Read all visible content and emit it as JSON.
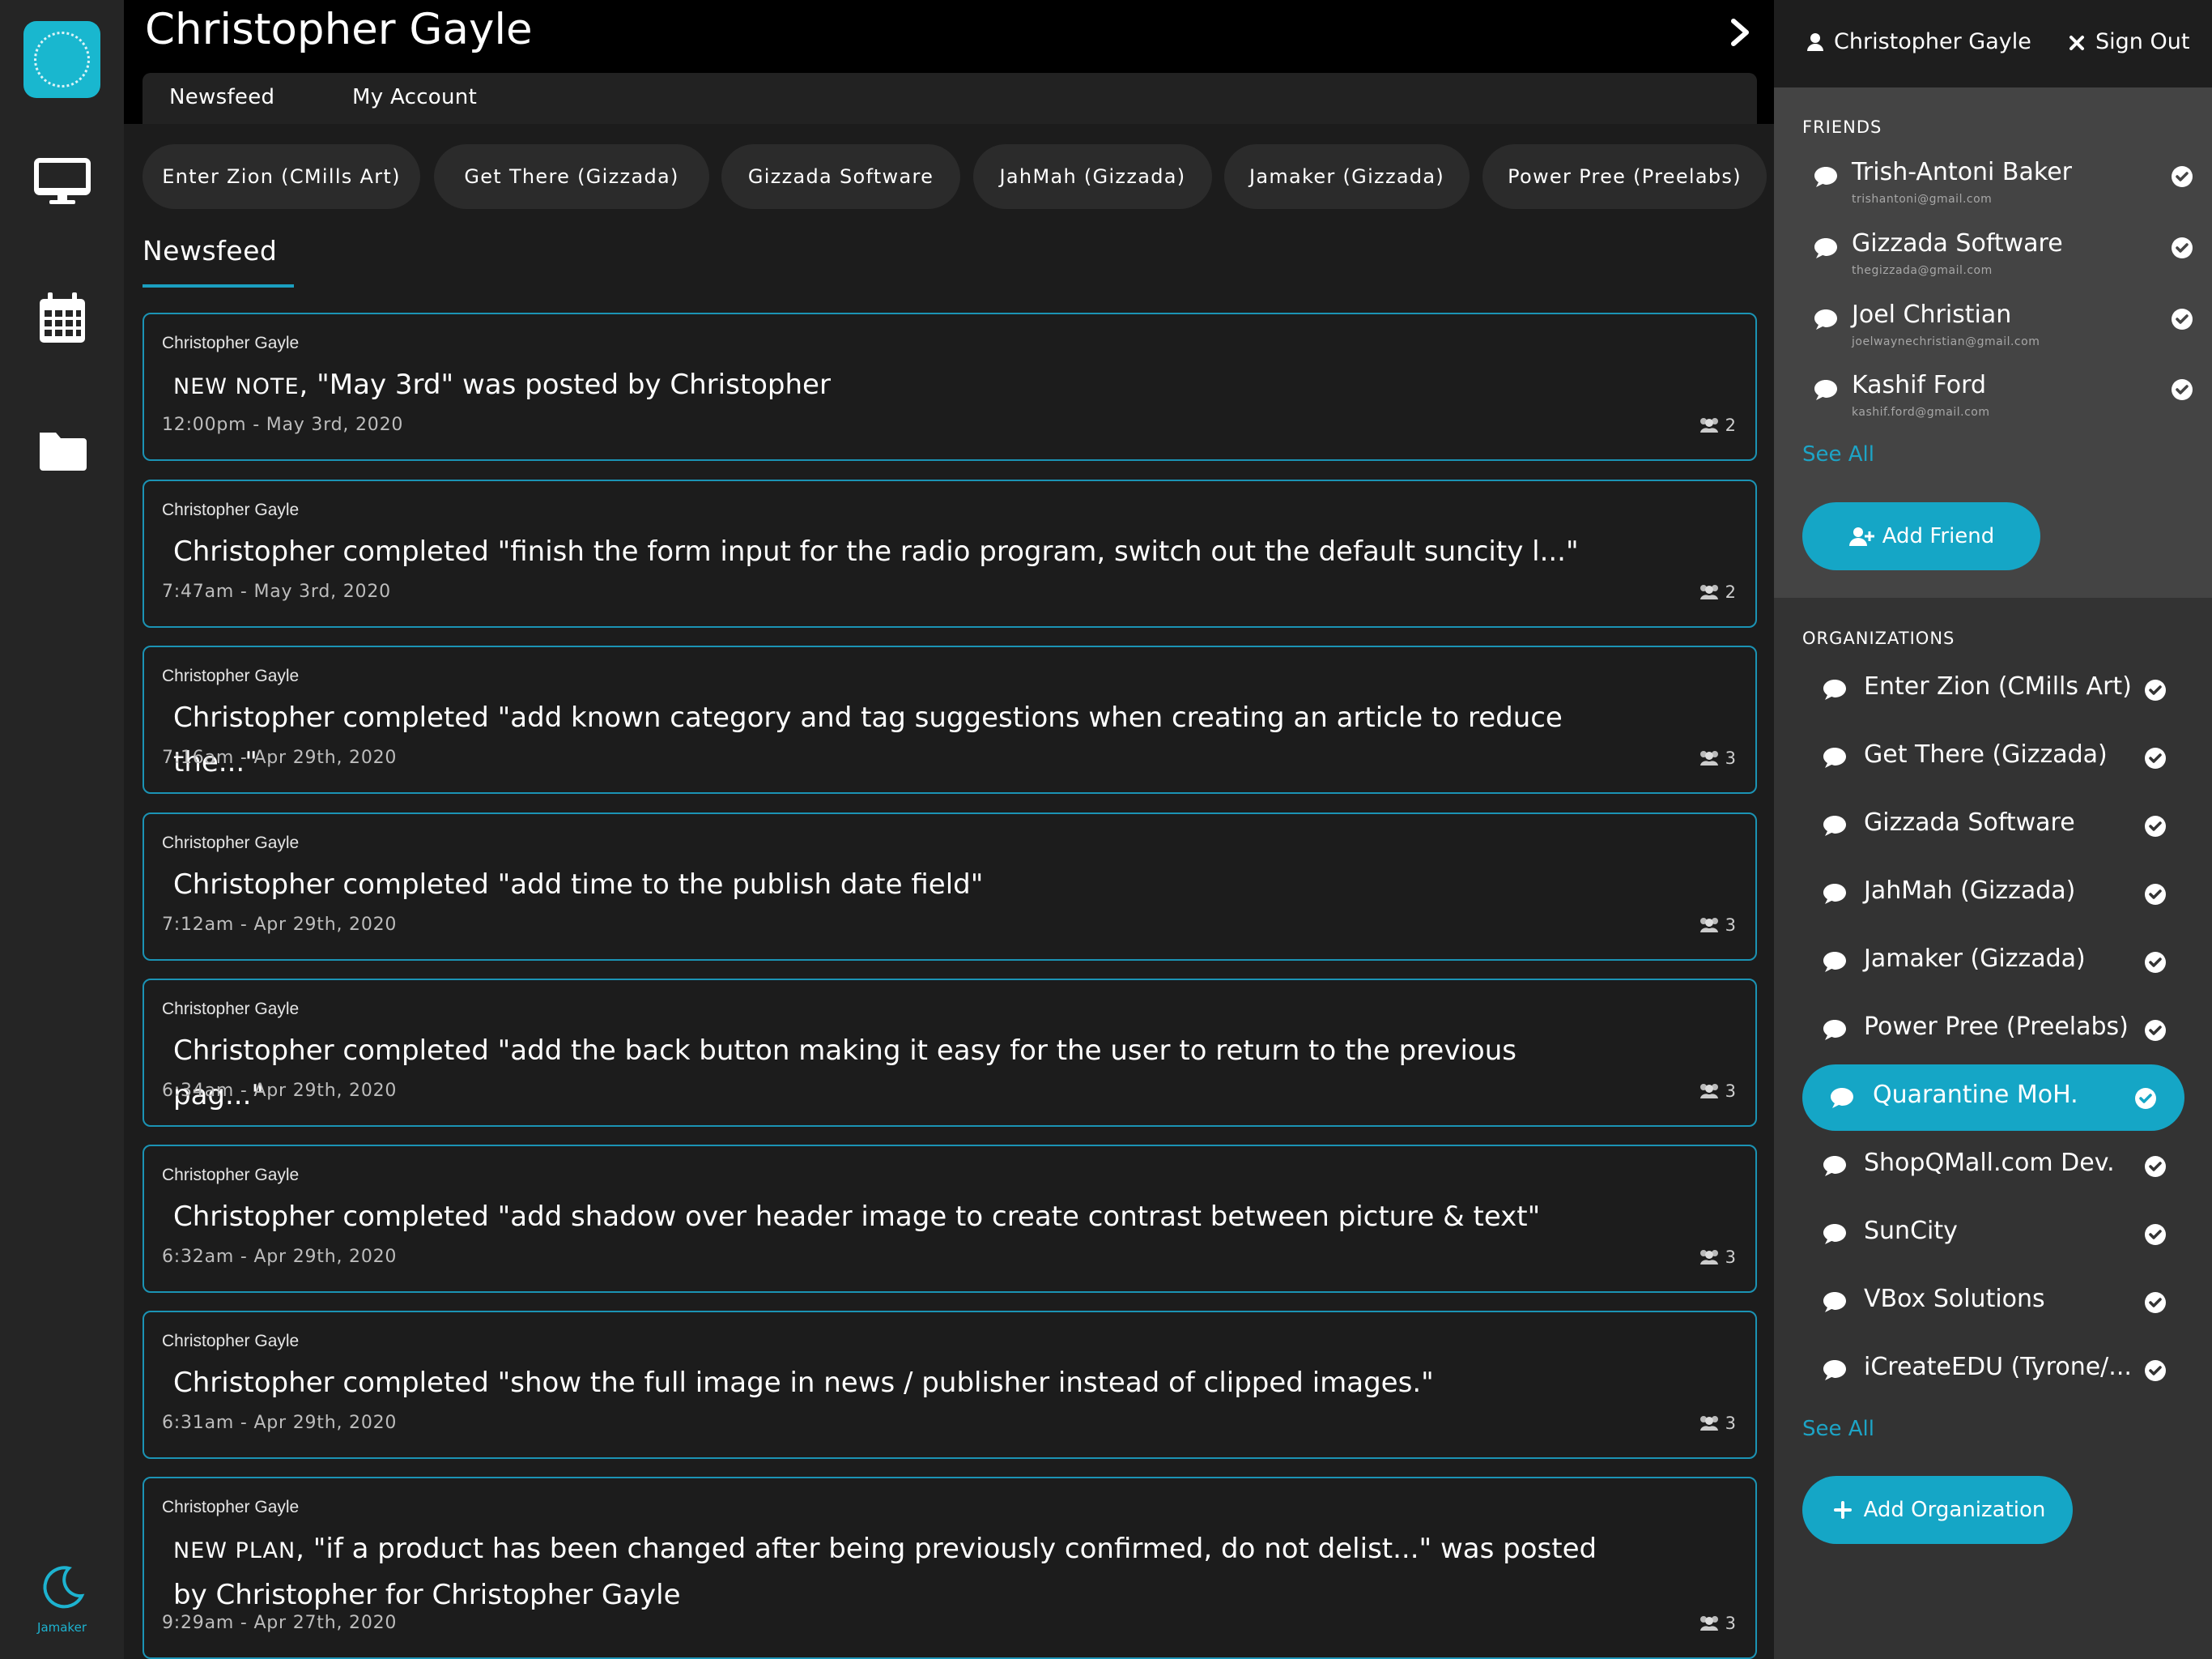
{
  "rail": {
    "app_label": "Jamaker",
    "icons": [
      "app-logo-icon",
      "desktop-icon",
      "calendar-icon",
      "folder-icon",
      "moon-icon"
    ]
  },
  "header": {
    "title": "Christopher Gayle",
    "tabs": [
      {
        "label": "Newsfeed"
      },
      {
        "label": "My Account"
      }
    ]
  },
  "org_pills": [
    {
      "label": "Enter Zion (CMills Art)"
    },
    {
      "label": "Get There (Gizzada)"
    },
    {
      "label": "Gizzada Software"
    },
    {
      "label": "JahMah (Gizzada)"
    },
    {
      "label": "Jamaker (Gizzada)"
    },
    {
      "label": "Power Pree (Preelabs)"
    }
  ],
  "feed": {
    "heading": "Newsfeed",
    "items": [
      {
        "author": "Christopher Gayle",
        "kind": "NEW NOTE",
        "pre": ", ",
        "text": "\"May 3rd\" was posted by Christopher",
        "time": "12:00pm - May 3rd, 2020",
        "count": "2"
      },
      {
        "author": "Christopher Gayle",
        "kind": "",
        "pre": "",
        "text": "Christopher completed \"finish the form input for the radio program, switch out the default suncity l...\"",
        "time": "7:47am - May 3rd, 2020",
        "count": "2"
      },
      {
        "author": "Christopher Gayle",
        "kind": "",
        "pre": "",
        "text": "Christopher completed \"add known category and tag suggestions when creating an article to reduce the...\"",
        "time": "7:16am - Apr 29th, 2020",
        "count": "3"
      },
      {
        "author": "Christopher Gayle",
        "kind": "",
        "pre": "",
        "text": "Christopher completed \"add time to the publish date field\"",
        "time": "7:12am - Apr 29th, 2020",
        "count": "3"
      },
      {
        "author": "Christopher Gayle",
        "kind": "",
        "pre": "",
        "text": "Christopher completed \"add the back button making it easy for the user to return to the previous pag...\"",
        "time": "6:34am - Apr 29th, 2020",
        "count": "3"
      },
      {
        "author": "Christopher Gayle",
        "kind": "",
        "pre": "",
        "text": "Christopher completed \"add shadow over header image to create contrast between picture & text\"",
        "time": "6:32am - Apr 29th, 2020",
        "count": "3"
      },
      {
        "author": "Christopher Gayle",
        "kind": "",
        "pre": "",
        "text": "Christopher completed \"show the full image in news / publisher instead of clipped images.\"",
        "time": "6:31am - Apr 29th, 2020",
        "count": "3"
      },
      {
        "author": "Christopher Gayle",
        "kind": "NEW PLAN",
        "pre": ", ",
        "text": "\"if a product has been changed after being previously confirmed, do not delist...\" was posted by Christopher for Christopher Gayle",
        "time": "9:29am - Apr 27th, 2020",
        "count": "3"
      }
    ]
  },
  "panel": {
    "user_name": "Christopher Gayle",
    "sign_out": "Sign Out",
    "friends_label": "FRIENDS",
    "friends": [
      {
        "name": "Trish-Antoni Baker",
        "email": "trishantoni@gmail.com"
      },
      {
        "name": "Gizzada Software",
        "email": "thegizzada@gmail.com"
      },
      {
        "name": "Joel Christian",
        "email": "joelwaynechristian@gmail.com"
      },
      {
        "name": "Kashif Ford",
        "email": "kashif.ford@gmail.com"
      }
    ],
    "friends_see_all": "See All",
    "add_friend": "Add Friend",
    "orgs_label": "ORGANIZATIONS",
    "orgs": [
      {
        "name": "Enter Zion (CMills Art)",
        "active": false
      },
      {
        "name": "Get There (Gizzada)",
        "active": false
      },
      {
        "name": "Gizzada Software",
        "active": false
      },
      {
        "name": "JahMah (Gizzada)",
        "active": false
      },
      {
        "name": "Jamaker (Gizzada)",
        "active": false
      },
      {
        "name": "Power Pree (Preelabs)",
        "active": false
      },
      {
        "name": "Quarantine MoH.",
        "active": true
      },
      {
        "name": "ShopQMall.com Dev.",
        "active": false
      },
      {
        "name": "SunCity",
        "active": false
      },
      {
        "name": "VBox Solutions",
        "active": false
      },
      {
        "name": "iCreateEDU (Tyrone/...",
        "active": false
      }
    ],
    "orgs_see_all": "See All",
    "add_org": "Add Organization"
  },
  "colors": {
    "accent": "#15a6c6",
    "card_border": "#1b93b4",
    "main_bg": "#1c1c1c",
    "panel_bg": "#333333"
  }
}
